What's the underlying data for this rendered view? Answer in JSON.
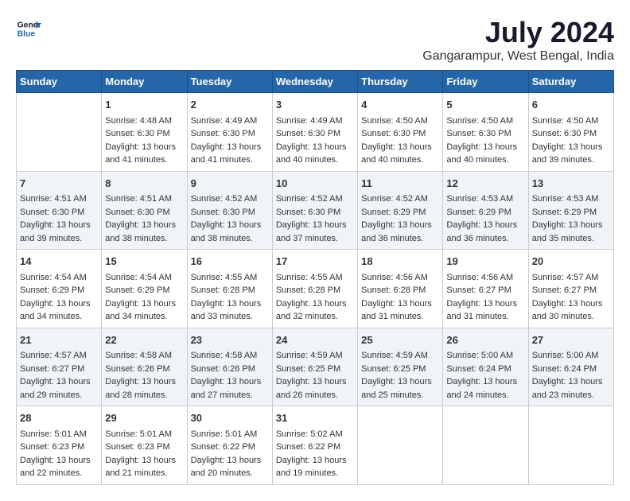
{
  "logo": {
    "line1": "General",
    "line2": "Blue"
  },
  "title": "July 2024",
  "subtitle": "Gangarampur, West Bengal, India",
  "days_of_week": [
    "Sunday",
    "Monday",
    "Tuesday",
    "Wednesday",
    "Thursday",
    "Friday",
    "Saturday"
  ],
  "weeks": [
    [
      {
        "day": "",
        "content": ""
      },
      {
        "day": "1",
        "content": "Sunrise: 4:48 AM\nSunset: 6:30 PM\nDaylight: 13 hours\nand 41 minutes."
      },
      {
        "day": "2",
        "content": "Sunrise: 4:49 AM\nSunset: 6:30 PM\nDaylight: 13 hours\nand 41 minutes."
      },
      {
        "day": "3",
        "content": "Sunrise: 4:49 AM\nSunset: 6:30 PM\nDaylight: 13 hours\nand 40 minutes."
      },
      {
        "day": "4",
        "content": "Sunrise: 4:50 AM\nSunset: 6:30 PM\nDaylight: 13 hours\nand 40 minutes."
      },
      {
        "day": "5",
        "content": "Sunrise: 4:50 AM\nSunset: 6:30 PM\nDaylight: 13 hours\nand 40 minutes."
      },
      {
        "day": "6",
        "content": "Sunrise: 4:50 AM\nSunset: 6:30 PM\nDaylight: 13 hours\nand 39 minutes."
      }
    ],
    [
      {
        "day": "7",
        "content": "Sunrise: 4:51 AM\nSunset: 6:30 PM\nDaylight: 13 hours\nand 39 minutes."
      },
      {
        "day": "8",
        "content": "Sunrise: 4:51 AM\nSunset: 6:30 PM\nDaylight: 13 hours\nand 38 minutes."
      },
      {
        "day": "9",
        "content": "Sunrise: 4:52 AM\nSunset: 6:30 PM\nDaylight: 13 hours\nand 38 minutes."
      },
      {
        "day": "10",
        "content": "Sunrise: 4:52 AM\nSunset: 6:30 PM\nDaylight: 13 hours\nand 37 minutes."
      },
      {
        "day": "11",
        "content": "Sunrise: 4:52 AM\nSunset: 6:29 PM\nDaylight: 13 hours\nand 36 minutes."
      },
      {
        "day": "12",
        "content": "Sunrise: 4:53 AM\nSunset: 6:29 PM\nDaylight: 13 hours\nand 36 minutes."
      },
      {
        "day": "13",
        "content": "Sunrise: 4:53 AM\nSunset: 6:29 PM\nDaylight: 13 hours\nand 35 minutes."
      }
    ],
    [
      {
        "day": "14",
        "content": "Sunrise: 4:54 AM\nSunset: 6:29 PM\nDaylight: 13 hours\nand 34 minutes."
      },
      {
        "day": "15",
        "content": "Sunrise: 4:54 AM\nSunset: 6:29 PM\nDaylight: 13 hours\nand 34 minutes."
      },
      {
        "day": "16",
        "content": "Sunrise: 4:55 AM\nSunset: 6:28 PM\nDaylight: 13 hours\nand 33 minutes."
      },
      {
        "day": "17",
        "content": "Sunrise: 4:55 AM\nSunset: 6:28 PM\nDaylight: 13 hours\nand 32 minutes."
      },
      {
        "day": "18",
        "content": "Sunrise: 4:56 AM\nSunset: 6:28 PM\nDaylight: 13 hours\nand 31 minutes."
      },
      {
        "day": "19",
        "content": "Sunrise: 4:56 AM\nSunset: 6:27 PM\nDaylight: 13 hours\nand 31 minutes."
      },
      {
        "day": "20",
        "content": "Sunrise: 4:57 AM\nSunset: 6:27 PM\nDaylight: 13 hours\nand 30 minutes."
      }
    ],
    [
      {
        "day": "21",
        "content": "Sunrise: 4:57 AM\nSunset: 6:27 PM\nDaylight: 13 hours\nand 29 minutes."
      },
      {
        "day": "22",
        "content": "Sunrise: 4:58 AM\nSunset: 6:26 PM\nDaylight: 13 hours\nand 28 minutes."
      },
      {
        "day": "23",
        "content": "Sunrise: 4:58 AM\nSunset: 6:26 PM\nDaylight: 13 hours\nand 27 minutes."
      },
      {
        "day": "24",
        "content": "Sunrise: 4:59 AM\nSunset: 6:25 PM\nDaylight: 13 hours\nand 26 minutes."
      },
      {
        "day": "25",
        "content": "Sunrise: 4:59 AM\nSunset: 6:25 PM\nDaylight: 13 hours\nand 25 minutes."
      },
      {
        "day": "26",
        "content": "Sunrise: 5:00 AM\nSunset: 6:24 PM\nDaylight: 13 hours\nand 24 minutes."
      },
      {
        "day": "27",
        "content": "Sunrise: 5:00 AM\nSunset: 6:24 PM\nDaylight: 13 hours\nand 23 minutes."
      }
    ],
    [
      {
        "day": "28",
        "content": "Sunrise: 5:01 AM\nSunset: 6:23 PM\nDaylight: 13 hours\nand 22 minutes."
      },
      {
        "day": "29",
        "content": "Sunrise: 5:01 AM\nSunset: 6:23 PM\nDaylight: 13 hours\nand 21 minutes."
      },
      {
        "day": "30",
        "content": "Sunrise: 5:01 AM\nSunset: 6:22 PM\nDaylight: 13 hours\nand 20 minutes."
      },
      {
        "day": "31",
        "content": "Sunrise: 5:02 AM\nSunset: 6:22 PM\nDaylight: 13 hours\nand 19 minutes."
      },
      {
        "day": "",
        "content": ""
      },
      {
        "day": "",
        "content": ""
      },
      {
        "day": "",
        "content": ""
      }
    ]
  ]
}
